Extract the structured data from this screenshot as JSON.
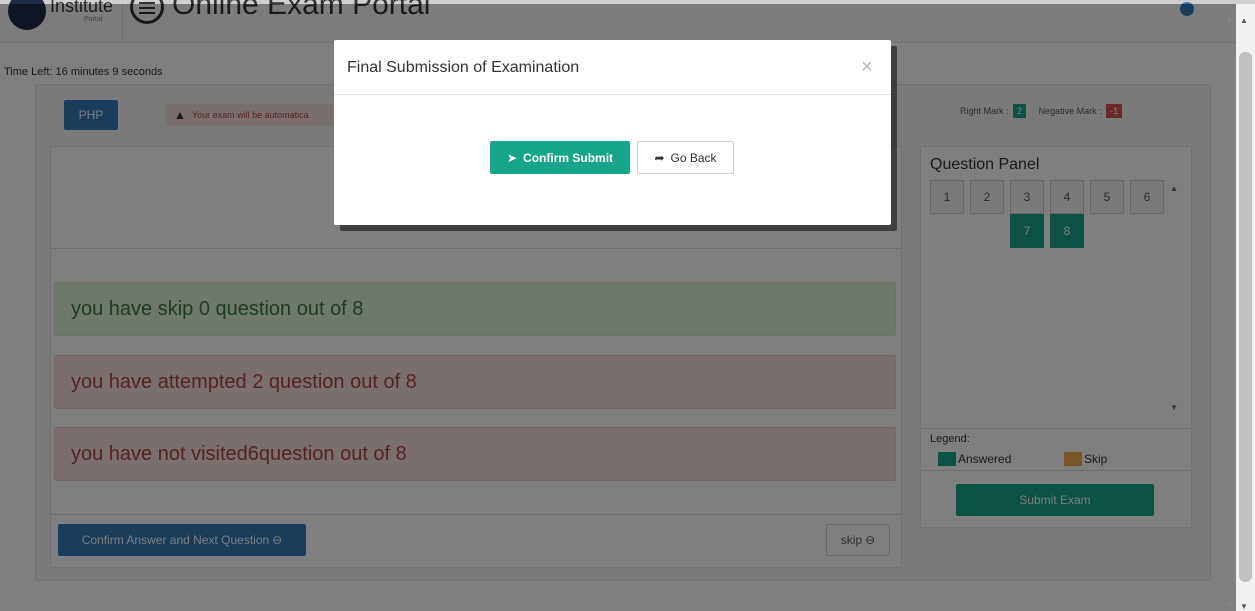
{
  "header": {
    "logo_text": "Institute",
    "logo_sub": "Portal",
    "title": "Online Exam Portal"
  },
  "timer": {
    "text": "Time Left: 16 minutes 9 seconds"
  },
  "subject": {
    "label": "PHP",
    "warning": "Your exam will be automatica"
  },
  "marks": {
    "right_label": "Right Mark :",
    "right_value": "2",
    "negative_label": "Negative Mark :",
    "negative_value": "-1",
    "right_color": "#17a589",
    "negative_color": "#d9534f"
  },
  "summary": {
    "skip": "you have skip 0 question out of 8",
    "attempted": "you have attempted 2 question out of 8",
    "not_visited": "you have not visited6question out of 8"
  },
  "actions": {
    "next_label": "Confirm Answer and Next Question",
    "skip_label": "skip"
  },
  "question_panel": {
    "title": "Question Panel",
    "questions": [
      {
        "num": "1",
        "status": "not-visited"
      },
      {
        "num": "2",
        "status": "not-visited"
      },
      {
        "num": "3",
        "status": "not-visited"
      },
      {
        "num": "4",
        "status": "not-visited"
      },
      {
        "num": "5",
        "status": "not-visited"
      },
      {
        "num": "6",
        "status": "not-visited"
      },
      {
        "num": "7",
        "status": "answered"
      },
      {
        "num": "8",
        "status": "answered"
      }
    ],
    "legend_label": "Legend:",
    "legend": [
      {
        "label": "Answered",
        "color": "#17a589"
      },
      {
        "label": "Skip",
        "color": "#f0ad4e"
      }
    ],
    "submit_label": "Submit Exam"
  },
  "modal": {
    "title": "Final Submission of Examination",
    "close": "×",
    "confirm_label": "Confirm Submit",
    "goback_label": "Go Back"
  },
  "icons": {
    "warning": "warning-icon",
    "arrow_circle": "arrow-circle-right-icon",
    "send": "send-icon",
    "share": "share-icon"
  }
}
